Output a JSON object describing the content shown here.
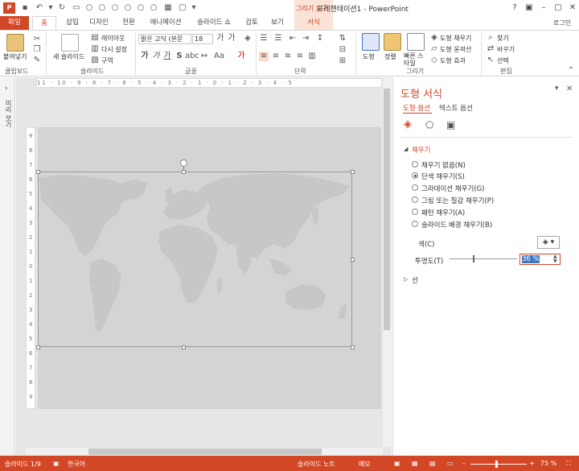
{
  "titlebar": {
    "doc_title": "프레젠테이션1 - PowerPoint",
    "context_group": "그리기 도구",
    "app_icon": "P"
  },
  "tabs": [
    "파일",
    "홈",
    "삽입",
    "디자인",
    "전환",
    "애니메이션",
    "슬라이드 쇼",
    "검토",
    "보기",
    "서식"
  ],
  "login": "로그인",
  "ribbon": {
    "clipboard": {
      "label": "클립보드",
      "paste": "붙여넣기"
    },
    "slides": {
      "label": "슬라이드",
      "new_slide": "새 슬라이드",
      "layout": "레이아웃",
      "reset": "다시 설정",
      "section": "구역"
    },
    "font": {
      "label": "글꼴",
      "font_name": "맑은 고딕 (본문",
      "font_size": "18"
    },
    "paragraph": {
      "label": "단락"
    },
    "drawing": {
      "label": "그리기",
      "shapes": "도형",
      "arrange": "정렬",
      "quick_styles": "빠른 스타일",
      "fill": "도형 채우기",
      "outline": "도형 윤곽선",
      "effects": "도형 효과"
    },
    "editing": {
      "label": "편집",
      "find": "찾기",
      "replace": "바꾸기",
      "select": "선택"
    }
  },
  "thumb_pane_label": "미리 보기",
  "ruler": {
    "h": "11 · 10 · 9 · 8 · 7 · 6 · 5 · 4 · 3 · 2 · 1 · 0 · 1 · 2 · 3 · 4 · 5",
    "v": [
      "9",
      "8",
      "7",
      "6",
      "5",
      "4",
      "3",
      "2",
      "1",
      "0",
      "1",
      "2",
      "3",
      "4",
      "5",
      "6",
      "7",
      "8",
      "9"
    ]
  },
  "format_pane": {
    "title": "도형 서식",
    "tab_shape": "도형 옵션",
    "tab_text": "텍스트 옵션",
    "fill_header": "채우기",
    "fill_options": [
      {
        "label": "채우기 없음(N)",
        "selected": false
      },
      {
        "label": "단색 채우기(S)",
        "selected": true
      },
      {
        "label": "그라데이션 채우기(G)",
        "selected": false
      },
      {
        "label": "그림 또는 질감 채우기(P)",
        "selected": false
      },
      {
        "label": "패턴 채우기(A)",
        "selected": false
      },
      {
        "label": "슬라이드 배경 채우기(B)",
        "selected": false
      }
    ],
    "color_label": "색(C)",
    "transparency_label": "투명도(T)",
    "transparency_value": "36 %",
    "transparency": 0.36,
    "line_header": "선"
  },
  "status": {
    "slide": "슬라이드 1/9",
    "language": "한국어",
    "notes": "슬라이드 노트",
    "comments": "메모",
    "zoom": "75 %"
  },
  "colors": {
    "accent": "#d24726",
    "context": "#fbe2d6",
    "map": "#c7c7c7",
    "slide_bg": "#d4d4d4"
  }
}
